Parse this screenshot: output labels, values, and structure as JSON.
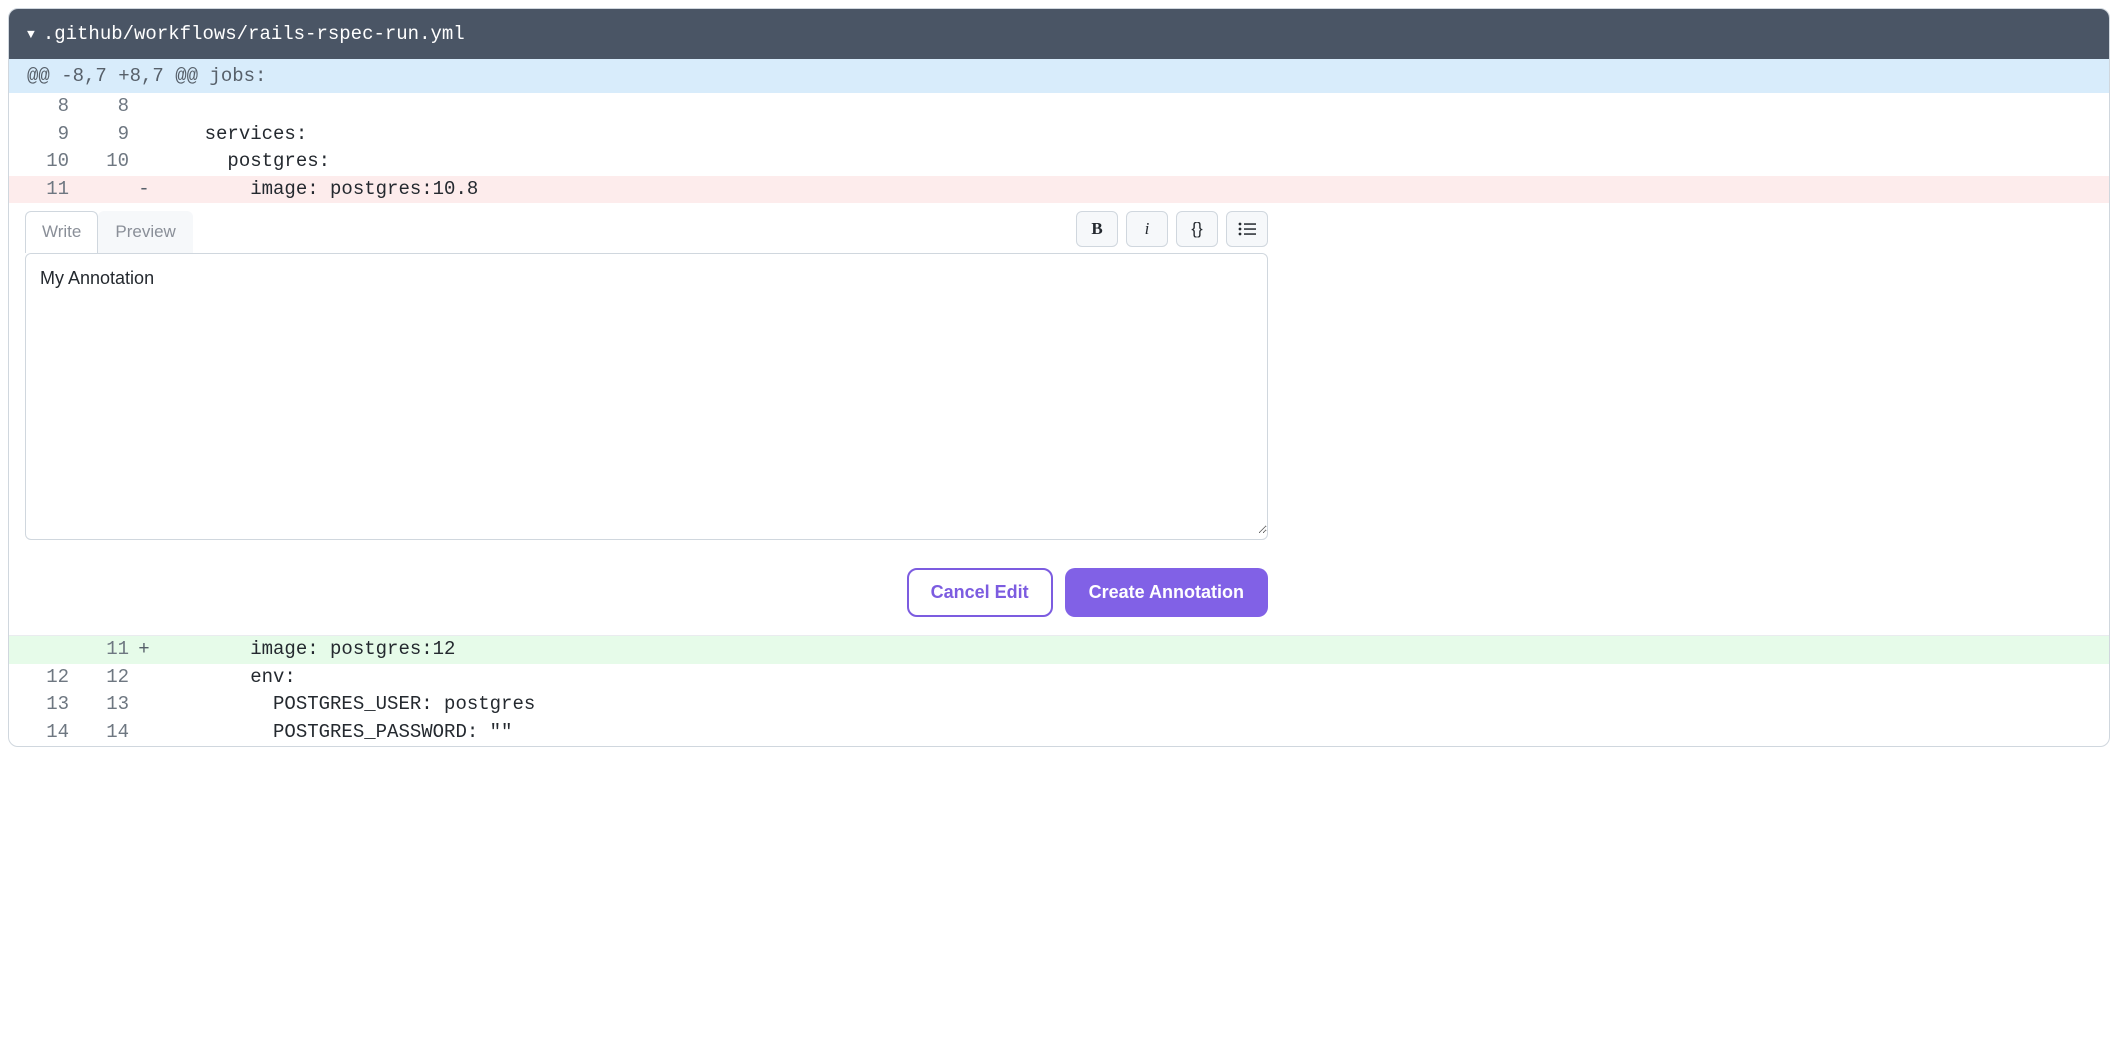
{
  "file": {
    "path": ".github/workflows/rails-rspec-run.yml"
  },
  "hunk": {
    "header": "@@ -8,7 +8,7 @@ jobs:"
  },
  "diff": [
    {
      "old": "8",
      "new": "8",
      "marker": "",
      "content": "",
      "type": "context"
    },
    {
      "old": "9",
      "new": "9",
      "marker": "",
      "content": "    services:",
      "type": "context"
    },
    {
      "old": "10",
      "new": "10",
      "marker": "",
      "content": "      postgres:",
      "type": "context"
    },
    {
      "old": "11",
      "new": "",
      "marker": "-",
      "content": "        image: postgres:10.8",
      "type": "deletion"
    }
  ],
  "diff_after": [
    {
      "old": "",
      "new": "11",
      "marker": "+",
      "content": "        image: postgres:12",
      "type": "addition"
    },
    {
      "old": "12",
      "new": "12",
      "marker": "",
      "content": "        env:",
      "type": "context"
    },
    {
      "old": "13",
      "new": "13",
      "marker": "",
      "content": "          POSTGRES_USER: postgres",
      "type": "context"
    },
    {
      "old": "14",
      "new": "14",
      "marker": "",
      "content": "          POSTGRES_PASSWORD: \"\"",
      "type": "context"
    }
  ],
  "annotation": {
    "tabs": {
      "write": "Write",
      "preview": "Preview"
    },
    "text": "My Annotation",
    "buttons": {
      "cancel": "Cancel Edit",
      "create": "Create Annotation"
    }
  }
}
